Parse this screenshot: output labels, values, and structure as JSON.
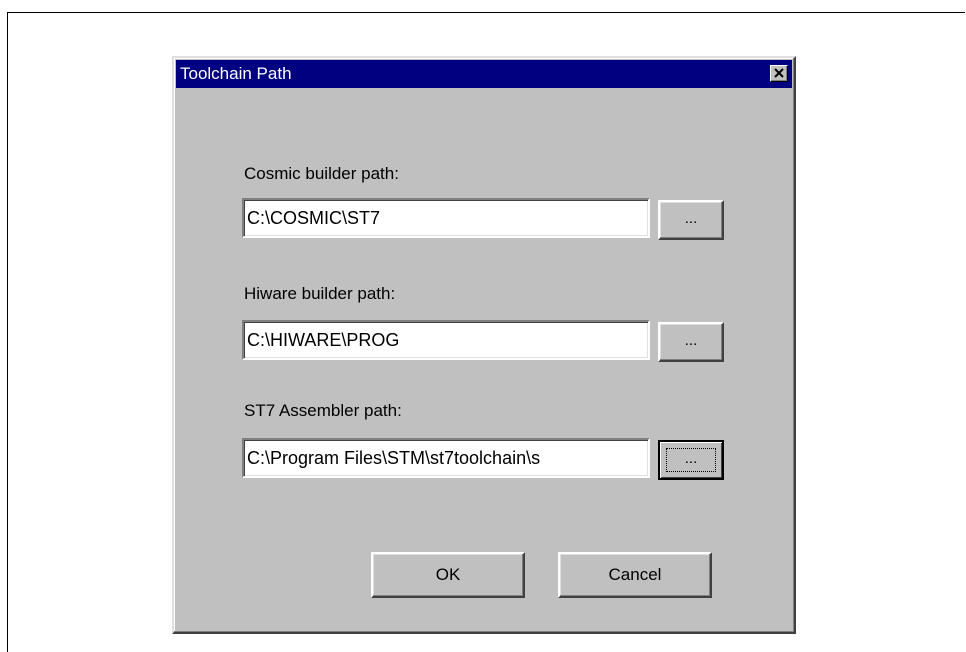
{
  "dialog": {
    "title": "Toolchain Path",
    "close_label": "✕"
  },
  "cosmic": {
    "label": "Cosmic builder path:",
    "value": "C:\\COSMIC\\ST7",
    "browse_label": "..."
  },
  "hiware": {
    "label": "Hiware builder path:",
    "value": "C:\\HIWARE\\PROG",
    "browse_label": "..."
  },
  "st7": {
    "label": "ST7 Assembler path:",
    "value": "C:\\Program Files\\STM\\st7toolchain\\s",
    "browse_label": "..."
  },
  "buttons": {
    "ok": "OK",
    "cancel": "Cancel"
  },
  "colors": {
    "titlebar": "#000080",
    "face": "#c0c0c0"
  }
}
